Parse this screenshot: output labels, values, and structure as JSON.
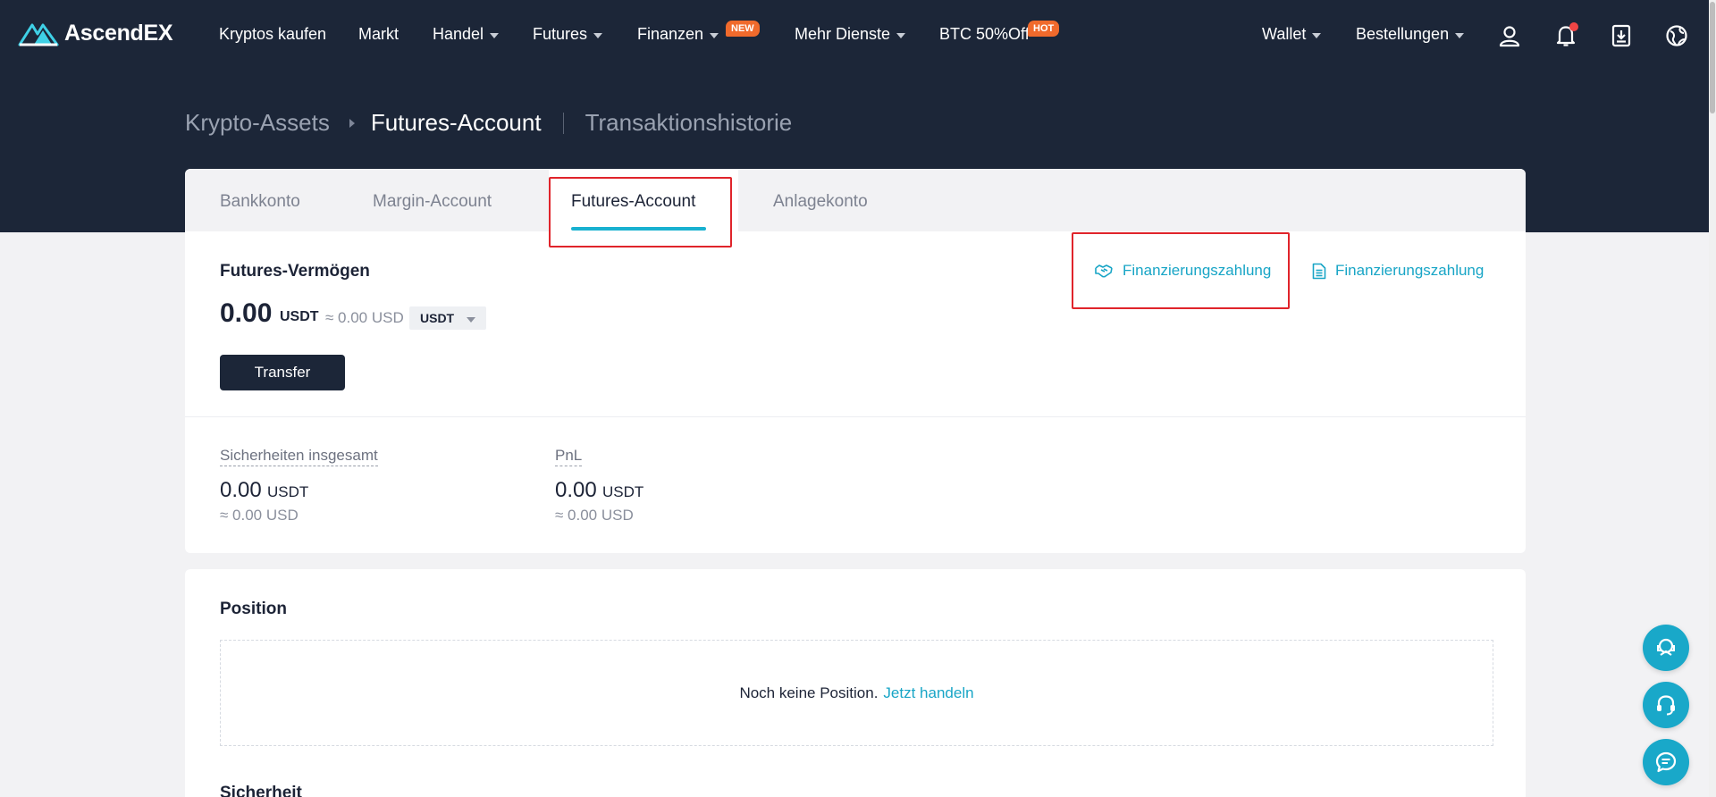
{
  "brand": {
    "name": "AscendEX"
  },
  "nav": {
    "items": [
      {
        "label": "Kryptos kaufen"
      },
      {
        "label": "Markt"
      },
      {
        "label": "Handel"
      },
      {
        "label": "Futures"
      },
      {
        "label": "Finanzen",
        "badge": "NEW"
      },
      {
        "label": "Mehr Dienste"
      },
      {
        "label": "BTC 50%Off",
        "badge": "HOT"
      }
    ],
    "right": [
      {
        "label": "Wallet"
      },
      {
        "label": "Bestellungen"
      }
    ],
    "icons": [
      "user-icon",
      "bell-icon",
      "download-icon",
      "globe-icon"
    ]
  },
  "breadcrumb": {
    "root": "Krypto-Assets",
    "current": "Futures-Account",
    "history": "Transaktionshistorie"
  },
  "tabs": [
    {
      "label": "Bankkonto"
    },
    {
      "label": "Margin-Account"
    },
    {
      "label": "Futures-Account",
      "active": true
    },
    {
      "label": "Anlagekonto"
    }
  ],
  "assets": {
    "title": "Futures-Vermögen",
    "amount": "0.00",
    "unit": "USDT",
    "approx": "≈ 0.00 USD",
    "currency": "USDT",
    "transfer_label": "Transfer",
    "links": [
      {
        "label": "Finanzierungszahlung",
        "icon": "handshake-icon"
      },
      {
        "label": "Finanzierungszahlung",
        "icon": "document-icon"
      }
    ]
  },
  "stats": [
    {
      "label": "Sicherheiten insgesamt",
      "value": "0.00",
      "unit": "USDT",
      "approx": "≈ 0.00 USD"
    },
    {
      "label": "PnL",
      "value": "0.00",
      "unit": "USDT",
      "approx": "≈ 0.00 USD"
    }
  ],
  "position": {
    "title": "Position",
    "empty_text": "Noch keine Position.",
    "trade_link": "Jetzt handeln"
  },
  "next_section": {
    "title": "Sicherheit"
  },
  "colors": {
    "dark": "#1c2638",
    "accent": "#18b1d0",
    "highlight": "#e0242b",
    "badge": "#f06a2c"
  }
}
